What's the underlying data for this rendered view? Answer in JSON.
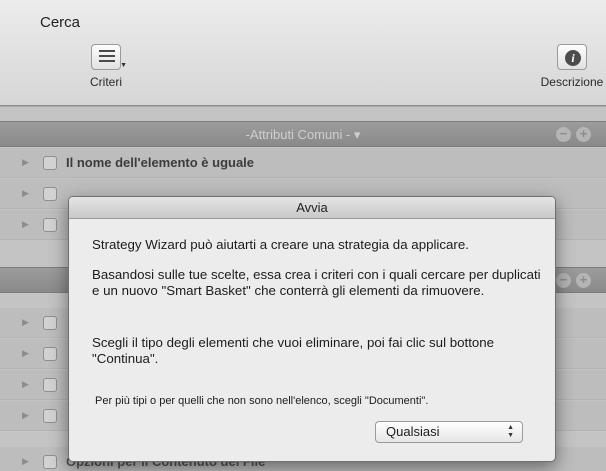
{
  "window": {
    "title": "Cerca"
  },
  "toolbar": {
    "criteri_label": "Criteri",
    "descrizione_label": "Descrizione"
  },
  "background": {
    "section1_title": "-Attributi Comuni -",
    "row1_text": "Il nome dell'elemento è uguale",
    "row_last_text": "Opzioni per il Contenuto del File"
  },
  "dialog": {
    "title": "Avvia",
    "paragraph1": "Strategy Wizard può aiutarti a creare una strategia da applicare.",
    "paragraph2": "Basandosi sulle tue scelte, essa crea i criteri con i quali cercare per duplicati e un nuovo \"Smart Basket\" che conterrà gli elementi da rimuovere.",
    "paragraph3": "Scegli il tipo degli elementi che vuoi eliminare, poi fai clic sul bottone \"Continua\".",
    "paragraph4": "Per più tipi o per quelli che non sono nell'elenco, scegli \"Documenti\".",
    "select_value": "Qualsiasi"
  },
  "icons": [
    "list-icon",
    "info-icon",
    "disclosure-triangle-icon",
    "remove-icon",
    "add-icon",
    "select-arrows-icon"
  ]
}
